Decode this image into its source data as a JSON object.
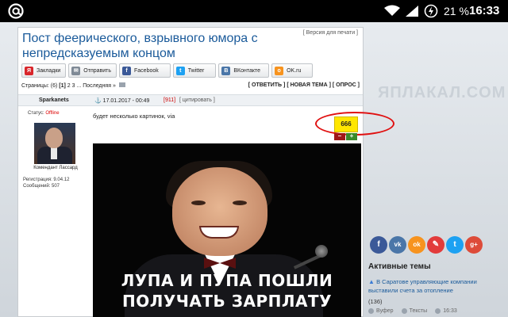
{
  "statusbar": {
    "battery_text": "21 %",
    "time": "16:33"
  },
  "post": {
    "print_link": "[ Версия для печати ]",
    "title": "Пост феерического, взрывного юмора с непредсказуемым концом",
    "share": [
      {
        "label": "Закладки",
        "icon": "yandex-bookmarks-icon",
        "icon_text": "Я",
        "color": "#d9262b"
      },
      {
        "label": "Отправить",
        "icon": "mail-icon",
        "icon_text": "✉",
        "color": "#7f8a96"
      },
      {
        "label": "Facebook",
        "icon": "facebook-icon",
        "icon_text": "f",
        "color": "#3b5998"
      },
      {
        "label": "Twitter",
        "icon": "twitter-icon",
        "icon_text": "t",
        "color": "#1da1f2"
      },
      {
        "label": "ВКонтакте",
        "icon": "vk-icon",
        "icon_text": "B",
        "color": "#4a76a8"
      },
      {
        "label": "OK.ru",
        "icon": "ok-icon",
        "icon_text": "o",
        "color": "#f7931e"
      }
    ],
    "pages": {
      "prefix": "Страницы: (6)",
      "current": "[1]",
      "rest": "2 3 ... Последняя »"
    },
    "actions": {
      "reply": "[ ОТВЕТИТЬ ]",
      "new_topic": "[ НОВАЯ ТЕМА ]",
      "poll": "[ ОПРОС ]"
    },
    "author": "Sparkanets",
    "date": "17.01.2017 - 00:49",
    "number": "[911]",
    "quote": "[ цитировать ]",
    "status_label": "Статус:",
    "status_value": "Offline",
    "rank": "Комендант Лассард",
    "registration": "Регистрация: 9.04.12",
    "messages": "Сообщений: 507",
    "text": "будет несколько картинок, via",
    "rating": "666",
    "vote_minus": "–",
    "vote_plus": "+",
    "meme_caption_1": "ЛУПА И ПУПА ПОШЛИ",
    "meme_caption_2": "ПОЛУЧАТЬ ЗАРПЛАТУ"
  },
  "sidebar": {
    "watermark": "ЯПЛАКАЛ.COM",
    "social": [
      {
        "name": "facebook-icon",
        "glyph": "f",
        "color": "#3b5998"
      },
      {
        "name": "vk-icon",
        "glyph": "vk",
        "color": "#4a76a8"
      },
      {
        "name": "ok-icon",
        "glyph": "ok",
        "color": "#f7931e"
      },
      {
        "name": "livejournal-icon",
        "glyph": "✎",
        "color": "#e23b3b"
      },
      {
        "name": "twitter-icon",
        "glyph": "t",
        "color": "#1da1f2"
      },
      {
        "name": "google-plus-icon",
        "glyph": "g+",
        "color": "#dd4b39"
      }
    ],
    "active_title": "Активные темы",
    "topic_title": "В Саратове управляющие компании выставили счета за отопление",
    "topic_count": "(136)",
    "topic_meta": [
      {
        "label": "Вуфер"
      },
      {
        "label": "Тексты"
      },
      {
        "label": "16:33"
      }
    ]
  }
}
